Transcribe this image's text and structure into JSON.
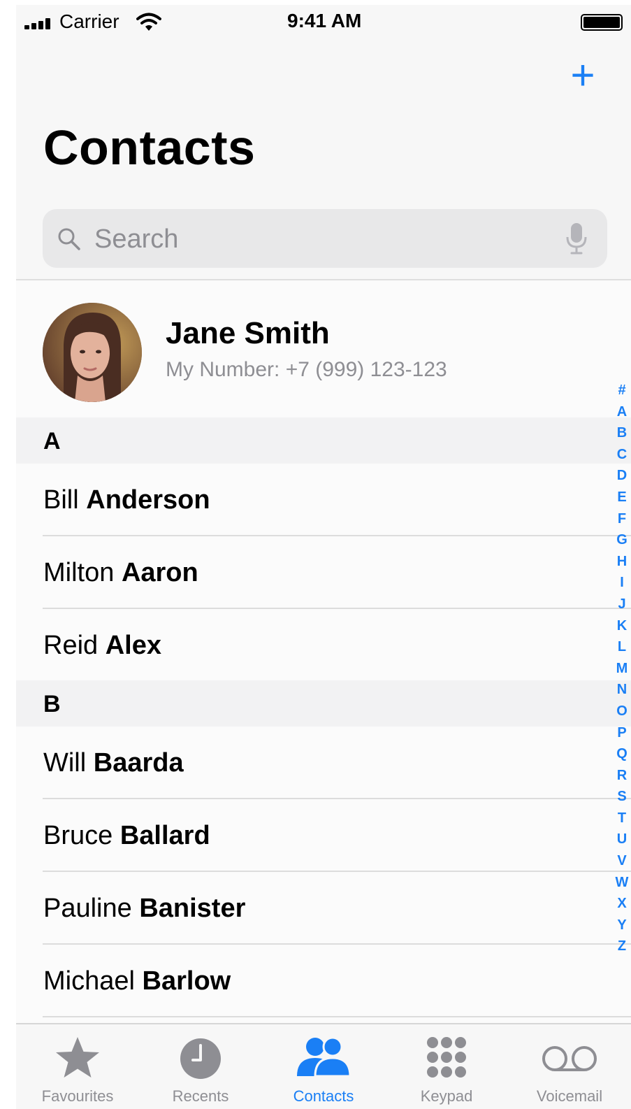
{
  "status_bar": {
    "carrier": "Carrier",
    "time": "9:41 AM"
  },
  "header": {
    "add_label": "+",
    "title": "Contacts"
  },
  "search": {
    "placeholder": "Search"
  },
  "my_card": {
    "name": "Jane Smith",
    "number": "My Number: +7 (999) 123-123"
  },
  "sections": [
    {
      "letter": "A",
      "contacts": [
        {
          "first": "Bill",
          "last": "Anderson"
        },
        {
          "first": "Milton",
          "last": "Aaron"
        },
        {
          "first": "Reid",
          "last": "Alex"
        }
      ]
    },
    {
      "letter": "B",
      "contacts": [
        {
          "first": "Will",
          "last": "Baarda"
        },
        {
          "first": "Bruce",
          "last": "Ballard"
        },
        {
          "first": "Pauline",
          "last": "Banister"
        },
        {
          "first": "Michael",
          "last": "Barlow"
        }
      ]
    }
  ],
  "index_letters": [
    "#",
    "A",
    "B",
    "C",
    "D",
    "E",
    "F",
    "G",
    "H",
    "I",
    "J",
    "K",
    "L",
    "M",
    "N",
    "O",
    "P",
    "Q",
    "R",
    "S",
    "T",
    "U",
    "V",
    "W",
    "X",
    "Y",
    "Z"
  ],
  "tabs": [
    {
      "label": "Favourites",
      "icon": "star-icon"
    },
    {
      "label": "Recents",
      "icon": "clock-icon"
    },
    {
      "label": "Contacts",
      "icon": "contacts-icon",
      "active": true
    },
    {
      "label": "Keypad",
      "icon": "keypad-icon"
    },
    {
      "label": "Voicemail",
      "icon": "voicemail-icon"
    }
  ],
  "colors": {
    "accent": "#1a7ff5",
    "inactive": "#8e8e93"
  }
}
